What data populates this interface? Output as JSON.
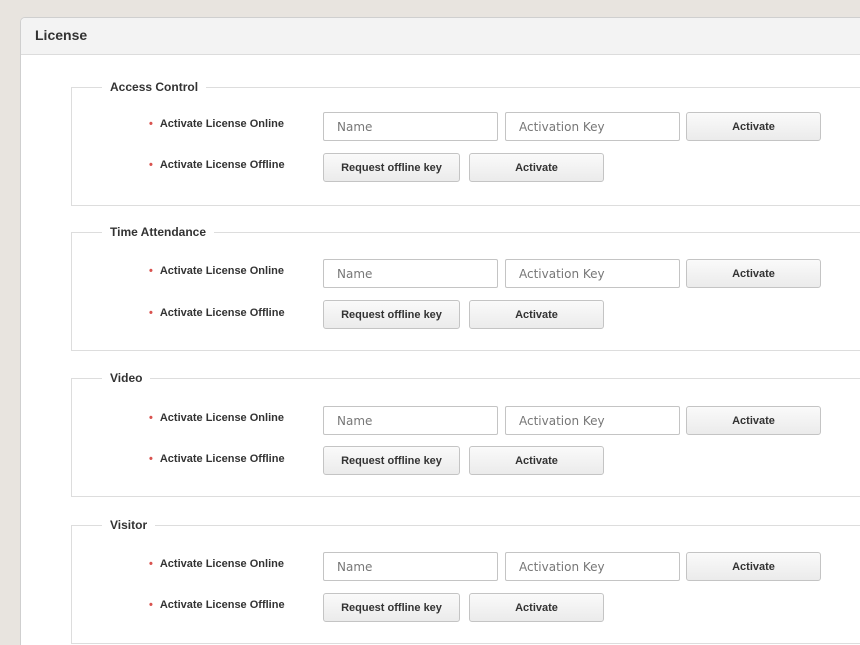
{
  "panel": {
    "title": "License"
  },
  "sections": [
    {
      "legend": "Access Control",
      "online_label": "Activate License Online",
      "offline_label": "Activate License Offline",
      "name_placeholder": "Name",
      "key_placeholder": "Activation Key",
      "activate_online_button": "Activate",
      "request_offline_button": "Request offline key",
      "activate_offline_button": "Activate"
    },
    {
      "legend": "Time Attendance",
      "online_label": "Activate License Online",
      "offline_label": "Activate License Offline",
      "name_placeholder": "Name",
      "key_placeholder": "Activation Key",
      "activate_online_button": "Activate",
      "request_offline_button": "Request offline key",
      "activate_offline_button": "Activate"
    },
    {
      "legend": "Video",
      "online_label": "Activate License Online",
      "offline_label": "Activate License Offline",
      "name_placeholder": "Name",
      "key_placeholder": "Activation Key",
      "activate_online_button": "Activate",
      "request_offline_button": "Request offline key",
      "activate_offline_button": "Activate"
    },
    {
      "legend": "Visitor",
      "online_label": "Activate License Online",
      "offline_label": "Activate License Offline",
      "name_placeholder": "Name",
      "key_placeholder": "Activation Key",
      "activate_online_button": "Activate",
      "request_offline_button": "Request offline key",
      "activate_offline_button": "Activate"
    }
  ],
  "bullet_char": "•",
  "colors": {
    "bullet": "#d9534f",
    "header_bg": "#f3f3f3",
    "page_bg": "#e8e4df"
  }
}
